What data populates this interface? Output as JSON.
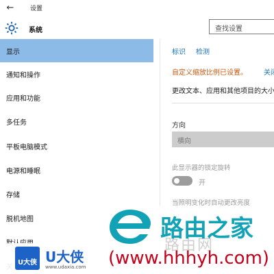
{
  "window": {
    "back_icon": "arrow-left-icon",
    "title": "设置"
  },
  "header": {
    "icon": "gear-icon",
    "title": "系统",
    "search_placeholder": "查找设置"
  },
  "sidebar": {
    "items": [
      {
        "label": "显示",
        "active": true
      },
      {
        "label": "通知和操作",
        "active": false
      },
      {
        "label": "应用和功能",
        "active": false
      },
      {
        "label": "多任务",
        "active": false
      },
      {
        "label": "平板电脑模式",
        "active": false
      },
      {
        "label": "电源和睡眠",
        "active": false
      },
      {
        "label": "存储",
        "active": false
      },
      {
        "label": "脱机地图",
        "active": false
      },
      {
        "label": "默认应用",
        "active": false
      },
      {
        "label": "关",
        "active": false
      }
    ]
  },
  "content": {
    "link_identify": "标识",
    "link_detect": "检测",
    "scaling_warning": "自定义缩放比例已设置。",
    "scaling_link": "关闭",
    "change_text": "更改文本、应用和其他项目的大小",
    "orientation_label": "方向",
    "orientation_value": "横向",
    "rotation_lock_label": "此显示器的锁定旋转",
    "rotation_lock_state": "开",
    "auto_brightness_label": "当照明变化时自动更改亮度"
  },
  "watermark": {
    "brand_main": "路由之家",
    "brand_url": "(www.hhhyh.com)",
    "brand_faint": "路由网",
    "badge_text": "U大侠",
    "badge_name": "U大侠",
    "badge_site": "www.udaxia.com"
  },
  "colors": {
    "active_nav": "#8dbbe7",
    "link": "#1a73b8",
    "warning": "#c55a11",
    "watermark_teal": "#11a3b5",
    "watermark_red": "#c6001a",
    "badge_blue": "#1d62c6"
  }
}
